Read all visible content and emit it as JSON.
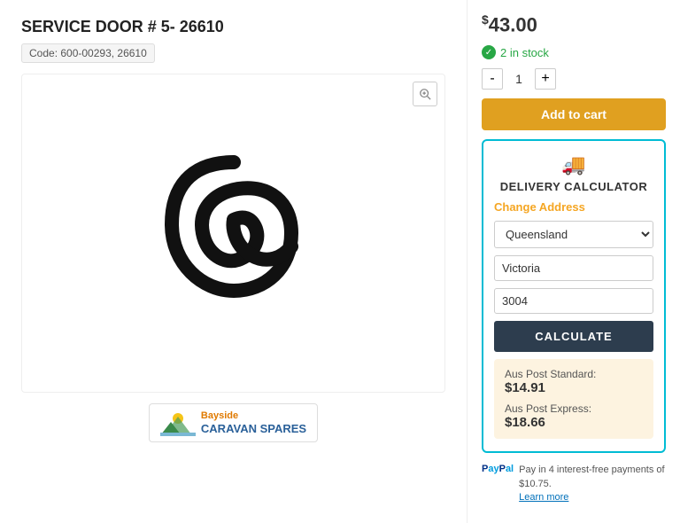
{
  "product": {
    "title": "SERVICE DOOR # 5- 26610",
    "code_label": "Code: 600-00293, 26610",
    "price_symbol": "$",
    "price_amount": "43.00",
    "stock_text": "2 in stock",
    "quantity": "1"
  },
  "buttons": {
    "add_to_cart": "Add to cart",
    "calculate": "CALCULATE",
    "qty_minus": "-",
    "qty_plus": "+"
  },
  "delivery": {
    "title": "DELIVERY CALCULATOR",
    "change_address": "Change Address",
    "state_selected": "Queensland",
    "suburb_value": "Victoria",
    "postcode_value": "3004",
    "results": {
      "standard_label": "Aus Post Standard:",
      "standard_price": "$14.91",
      "express_label": "Aus Post Express:",
      "express_price": "$18.66"
    }
  },
  "paypal": {
    "text": "Pay in 4 interest-free payments of $10.75.",
    "learn_more": "Learn more"
  },
  "brand": {
    "name": "Bayside",
    "subtitle": "CARAVAN SPARES"
  },
  "icons": {
    "zoom": "⊕",
    "truck": "🚚",
    "check": "✓"
  }
}
